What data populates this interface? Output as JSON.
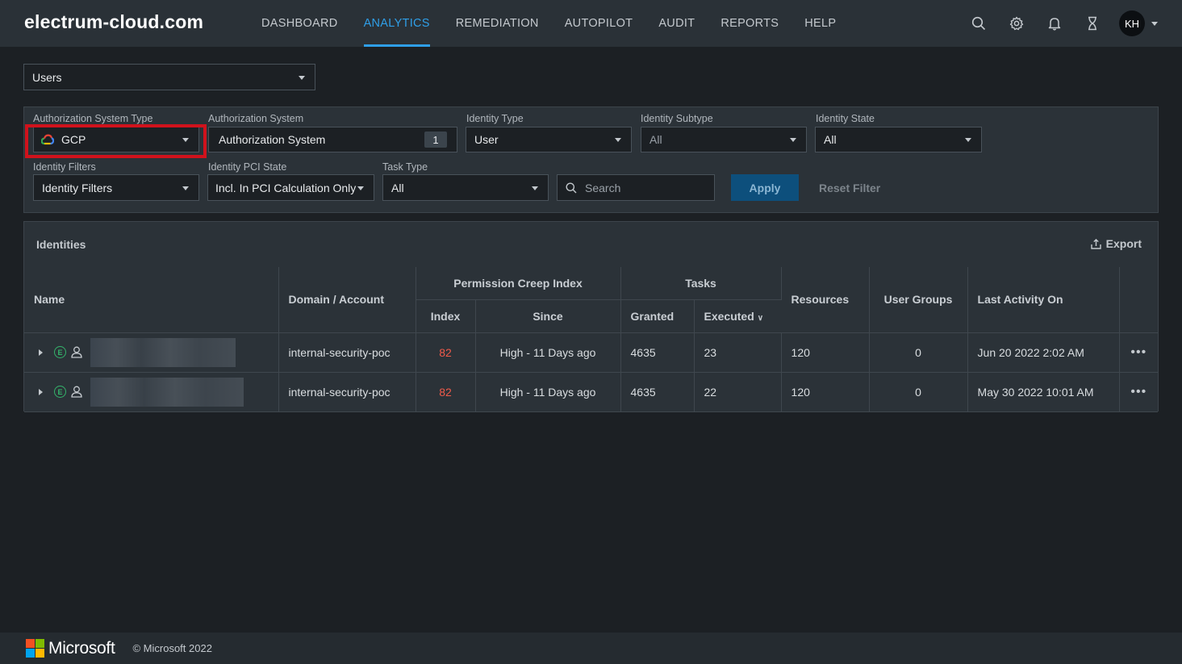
{
  "header": {
    "brand": "electrum-cloud.com",
    "nav": [
      {
        "label": "DASHBOARD"
      },
      {
        "label": "ANALYTICS"
      },
      {
        "label": "REMEDIATION"
      },
      {
        "label": "AUTOPILOT"
      },
      {
        "label": "AUDIT"
      },
      {
        "label": "REPORTS"
      },
      {
        "label": "HELP"
      }
    ],
    "active_nav": "ANALYTICS",
    "icons": [
      "search-icon",
      "gear-icon",
      "bell-icon",
      "hourglass-icon"
    ],
    "avatar_initials": "KH"
  },
  "view_select": {
    "value": "Users"
  },
  "filters": {
    "auth_system_type": {
      "label": "Authorization System Type",
      "value": "GCP"
    },
    "auth_system": {
      "label": "Authorization System",
      "value": "Authorization System",
      "count": "1"
    },
    "identity_type": {
      "label": "Identity Type",
      "value": "User"
    },
    "identity_subtype": {
      "label": "Identity Subtype",
      "value": "All"
    },
    "identity_state": {
      "label": "Identity State",
      "value": "All"
    },
    "identity_filters": {
      "label": "Identity Filters",
      "value": "Identity Filters"
    },
    "identity_pci_state": {
      "label": "Identity PCI State",
      "value": "Incl. In PCI Calculation Only"
    },
    "task_type": {
      "label": "Task Type",
      "value": "All"
    },
    "search": {
      "placeholder": "Search"
    },
    "apply_label": "Apply",
    "reset_label": "Reset Filter"
  },
  "identities": {
    "title": "Identities",
    "export_label": "Export",
    "columns": {
      "name": "Name",
      "domain": "Domain / Account",
      "pci_group": "Permission Creep Index",
      "pci_index": "Index",
      "pci_since": "Since",
      "tasks_group": "Tasks",
      "granted": "Granted",
      "executed": "Executed",
      "resources": "Resources",
      "user_groups": "User Groups",
      "last_activity": "Last Activity On"
    },
    "rows": [
      {
        "domain": "internal-security-poc",
        "index": "82",
        "since": "High - 11 Days ago",
        "granted": "4635",
        "executed": "23",
        "resources": "120",
        "user_groups": "0",
        "last_activity": "Jun 20 2022 2:02 AM"
      },
      {
        "domain": "internal-security-poc",
        "index": "82",
        "since": "High - 11 Days ago",
        "granted": "4635",
        "executed": "22",
        "resources": "120",
        "user_groups": "0",
        "last_activity": "May 30 2022 10:01 AM"
      }
    ]
  },
  "footer": {
    "brand": "Microsoft",
    "copyright": "© Microsoft 2022"
  },
  "colors": {
    "accent": "#2f9fe8",
    "highlight": "#d0121c",
    "pci_high": "#f05a4a"
  }
}
